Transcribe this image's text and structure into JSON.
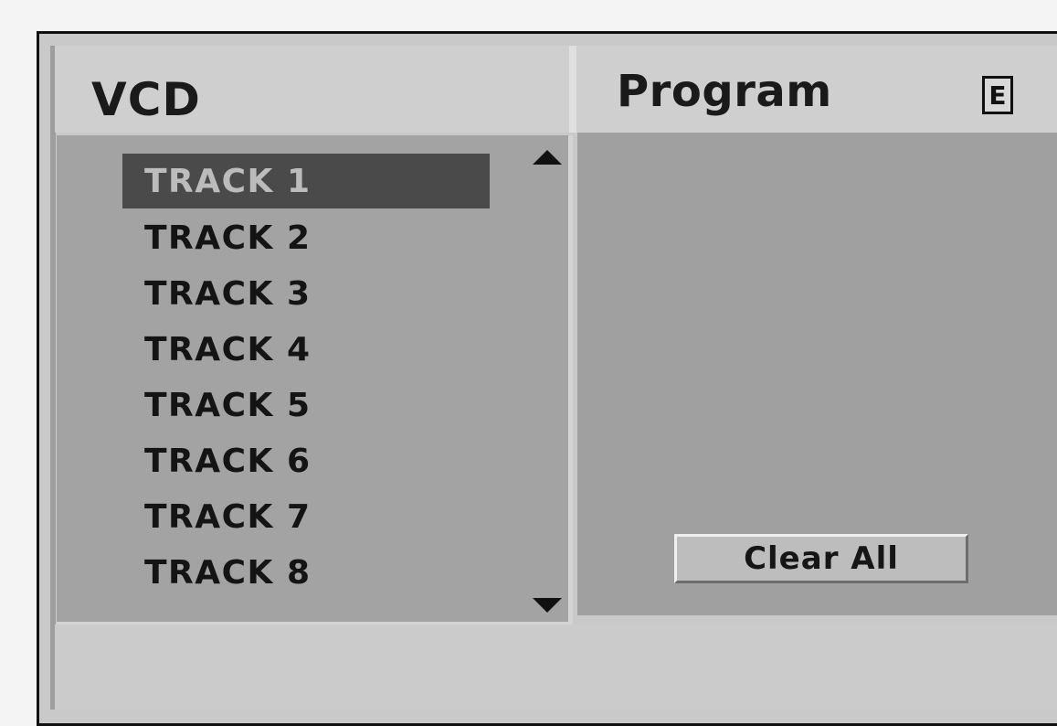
{
  "header": {
    "left_title": "VCD",
    "right_title": "Program",
    "right_badge": "E"
  },
  "tracks": [
    {
      "label": "TRACK 1",
      "selected": true
    },
    {
      "label": "TRACK 2",
      "selected": false
    },
    {
      "label": "TRACK 3",
      "selected": false
    },
    {
      "label": "TRACK 4",
      "selected": false
    },
    {
      "label": "TRACK 5",
      "selected": false
    },
    {
      "label": "TRACK 6",
      "selected": false
    },
    {
      "label": "TRACK 7",
      "selected": false
    },
    {
      "label": "TRACK 8",
      "selected": false
    }
  ],
  "program": {
    "clear_all_label": "Clear All"
  },
  "icons": {
    "scroll_up": "triangle-up-icon",
    "scroll_down": "triangle-down-icon"
  },
  "colors": {
    "selection_bg": "#4a4a4a",
    "panel_bg": "#a3a3a3"
  }
}
